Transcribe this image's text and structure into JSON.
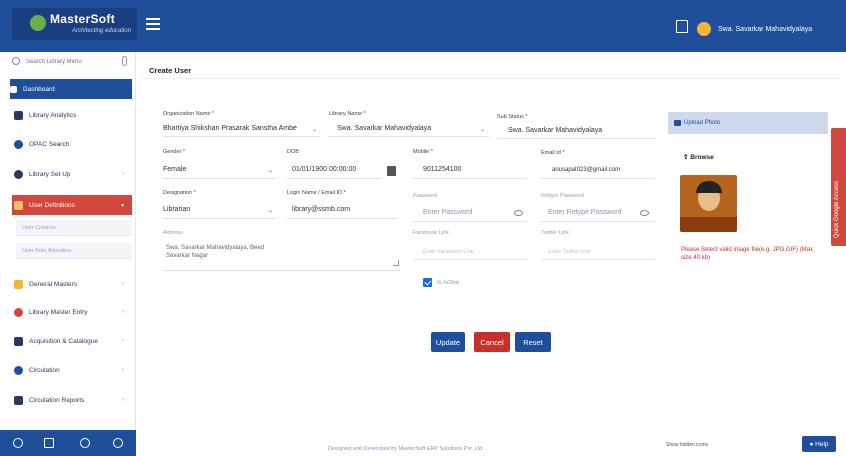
{
  "app": {
    "brand": "MasterSoft",
    "tagline": "Architecting education"
  },
  "header": {
    "user_name": "Swa. Savarkar Mahavidyalaya"
  },
  "sidebar": {
    "search_placeholder": "Search Library Menu",
    "items": [
      {
        "label": "Dashboard"
      },
      {
        "label": "Library Analytics"
      },
      {
        "label": "OPAC Search"
      },
      {
        "label": "Library Set Up"
      },
      {
        "label": "User Definitions"
      },
      {
        "label": "General Masters"
      },
      {
        "label": "Library Master Entry"
      },
      {
        "label": "Acquisition & Catalogue"
      },
      {
        "label": "Circulation"
      },
      {
        "label": "Circulation Reports"
      }
    ],
    "subitems": [
      {
        "label": "User Creation"
      },
      {
        "label": "User Role Allocation"
      }
    ]
  },
  "page": {
    "title": "Create User"
  },
  "form": {
    "org": {
      "label": "Organization Name *",
      "value": "Bhartiya Shikshan Prasarak Sanstha Ambe"
    },
    "library": {
      "label": "Library Name *",
      "value": "Swa. Savarkar Mahavidyalaya"
    },
    "sub_status": {
      "label": "Sub Status *",
      "value": "Swa. Savarkar Mahavidyalaya"
    },
    "gender": {
      "label": "Gender *",
      "value": "Female"
    },
    "dob": {
      "label": "DOB",
      "value": "01/01/1900 00:00:00"
    },
    "mobile": {
      "label": "Mobile *",
      "value": "9011254100"
    },
    "email": {
      "label": "Email Id *",
      "value": "anusapat023@gmail.com"
    },
    "designation": {
      "label": "Designation *",
      "value": "Librarian"
    },
    "login": {
      "label": "Login Name / Email ID *",
      "value": "library@ssmb.com"
    },
    "password": {
      "label": "Password",
      "placeholder": "Enter Password"
    },
    "retype": {
      "label": "Retype Password",
      "placeholder": "Enter Retype Password"
    },
    "address": {
      "label": "Address",
      "value": "Swa. Savarkar Mahavidyalaya, Beed Savarkar Nagar"
    },
    "facebook": {
      "label": "Facebook Link",
      "placeholder": "Enter Facebook Link"
    },
    "twitter": {
      "label": "Twitter Link",
      "placeholder": "Enter Twitter Link"
    },
    "active": {
      "label": "Is Active"
    }
  },
  "buttons": {
    "update": "Update",
    "cancel": "Cancel",
    "reset": "Reset"
  },
  "upload": {
    "title": "Upload Photo",
    "browse": "Browse",
    "note": "Please Select valid image file(e.g. JPG,GIF) (Max size 40 kb)"
  },
  "side_tab": {
    "label": "Quick Google Access"
  },
  "footer": {
    "credit": "Designed and Developed by MasterSoft ERP Solutions Pvt. Ltd.",
    "hidden_icons": "Show hidden icons",
    "help": "Help"
  },
  "colors": {
    "primary": "#1f4e9a",
    "danger": "#c8302c",
    "accent": "#d2473b"
  }
}
